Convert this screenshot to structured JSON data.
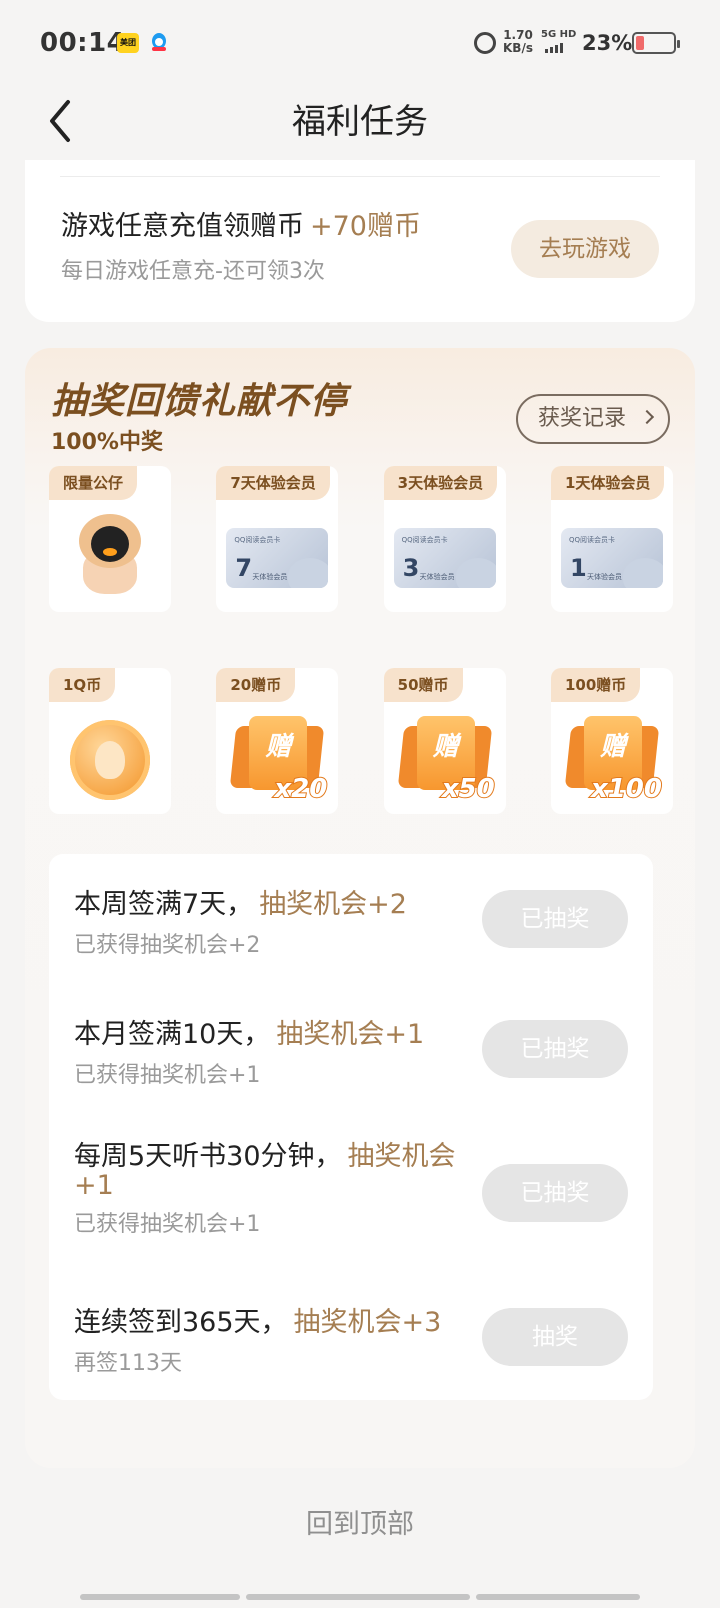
{
  "status_bar": {
    "time": "00:14",
    "app_icon_1": "美团",
    "speed_value": "1.70",
    "speed_unit": "KB/s",
    "network": "5G HD",
    "battery": "23%",
    "battery_level": 0.23
  },
  "header": {
    "title": "福利任务",
    "back_icon": "chevron-left-icon"
  },
  "game_task": {
    "title": "游戏任意充值领赠币",
    "reward": "+70赠币",
    "subtitle": "每日游戏任意充-还可领3次",
    "button": "去玩游戏"
  },
  "lottery": {
    "title": "抽奖回馈礼献不停",
    "subtitle": "100%中奖",
    "record_button": "获奖记录",
    "prizes_row1": [
      {
        "tag": "限量公仔",
        "icon": "penguin-doll-icon"
      },
      {
        "tag": "7天体验会员",
        "card_header": "QQ阅读会员卡",
        "card_num": "7",
        "card_sub": "天体验会员"
      },
      {
        "tag": "3天体验会员",
        "card_header": "QQ阅读会员卡",
        "card_num": "3",
        "card_sub": "天体验会员"
      },
      {
        "tag": "1天体验会员",
        "card_header": "QQ阅读会员卡",
        "card_num": "1",
        "card_sub": "天体验会员"
      }
    ],
    "prizes_row2": [
      {
        "tag": "1Q币",
        "icon": "qq-coin-icon"
      },
      {
        "tag": "20赠币",
        "gift_char": "赠",
        "amount": "x20"
      },
      {
        "tag": "50赠币",
        "gift_char": "赠",
        "amount": "x50"
      },
      {
        "tag": "100赠币",
        "gift_char": "赠",
        "amount": "x100"
      }
    ],
    "tasks": [
      {
        "title": "本周签满7天，",
        "reward": "抽奖机会+2",
        "sub": "已获得抽奖机会+2",
        "button": "已抽奖"
      },
      {
        "title": "本月签满10天，",
        "reward": "抽奖机会+1",
        "sub": "已获得抽奖机会+1",
        "button": "已抽奖"
      },
      {
        "title": "每周5天听书30分钟，",
        "reward": "抽奖机会+1",
        "sub": "已获得抽奖机会+1",
        "button": "已抽奖"
      },
      {
        "title": "连续签到365天，",
        "reward": "抽奖机会+3",
        "sub": "再签113天",
        "button": "抽奖"
      }
    ]
  },
  "footer": {
    "back_to_top": "回到顶部"
  },
  "colors": {
    "accent": "#a57e52",
    "lottery_title": "#7b4f20",
    "disabled_button": "#e5e5e5"
  }
}
